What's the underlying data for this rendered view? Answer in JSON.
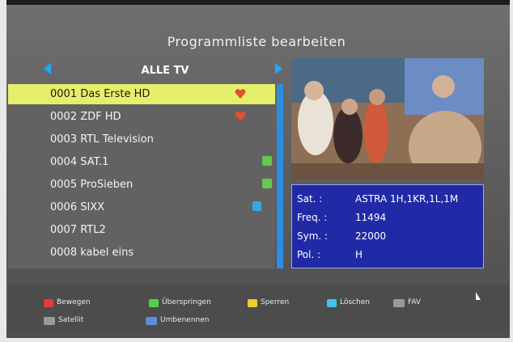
{
  "screen": {
    "title": "Programmliste bearbeiten",
    "category_label": "ALLE TV"
  },
  "channels": [
    {
      "label": "0001 Das Erste HD",
      "badge": "heart-icon"
    },
    {
      "label": "0002 ZDF HD",
      "badge": "heart-icon"
    },
    {
      "label": "0003 RTL Television",
      "badge": ""
    },
    {
      "label": "0004 SAT.1",
      "badge": "green-badge-icon"
    },
    {
      "label": "0005 ProSieben",
      "badge": "green-badge-icon"
    },
    {
      "label": "0006 SIXX",
      "badge": "blue-lock-icon"
    },
    {
      "label": "0007 RTL2",
      "badge": ""
    },
    {
      "label": "0008 kabel eins",
      "badge": ""
    }
  ],
  "info": {
    "sat_label": "Sat. :",
    "sat_value": "ASTRA 1H,1KR,1L,1M",
    "freq_label": "Freq. :",
    "freq_value": "11494",
    "sym_label": "Sym. :",
    "sym_value": "22000",
    "pol_label": "Pol. :",
    "pol_value": "H"
  },
  "footer": {
    "move": "Bewegen",
    "skip": "Überspringen",
    "lock": "Sperren",
    "delete": "Löschen",
    "fav": "FAV",
    "satellite": "Satellit",
    "rename": "Umbenennen"
  },
  "colors": {
    "highlight": "#e6ef69",
    "accent_blue": "#2d8de0",
    "info_bg": "#212aa6",
    "red_key": "#e23b3b",
    "green_key": "#4fd24a",
    "yellow_key": "#f0cf2a",
    "blue_key": "#3ec3ee"
  }
}
